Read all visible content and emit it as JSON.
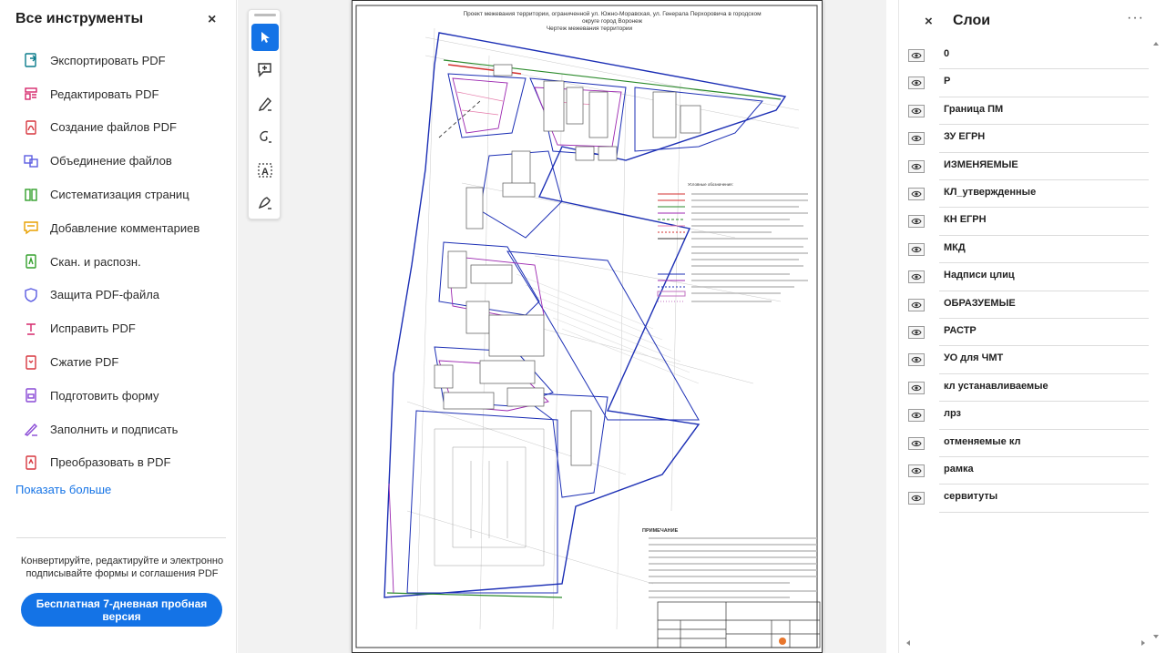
{
  "left_panel": {
    "title": "Все инструменты",
    "close": "×",
    "tools": [
      {
        "label": "Экспортировать PDF",
        "icon": "export-pdf-icon",
        "color": "#0a7c8c"
      },
      {
        "label": "Редактировать PDF",
        "icon": "edit-pdf-icon",
        "color": "#d6286b"
      },
      {
        "label": "Создание файлов PDF",
        "icon": "create-pdf-icon",
        "color": "#d7373f"
      },
      {
        "label": "Объединение файлов",
        "icon": "combine-files-icon",
        "color": "#5b5ce2"
      },
      {
        "label": "Систематизация страниц",
        "icon": "organize-pages-icon",
        "color": "#33a02c"
      },
      {
        "label": "Добавление комментариев",
        "icon": "comment-icon",
        "color": "#e8a000"
      },
      {
        "label": "Скан. и распозн.",
        "icon": "scan-ocr-icon",
        "color": "#33a02c"
      },
      {
        "label": "Защита PDF-файла",
        "icon": "protect-pdf-icon",
        "color": "#5b5ce2"
      },
      {
        "label": "Исправить PDF",
        "icon": "redact-pdf-icon",
        "color": "#d6286b"
      },
      {
        "label": "Сжатие PDF",
        "icon": "compress-pdf-icon",
        "color": "#d7373f"
      },
      {
        "label": "Подготовить форму",
        "icon": "prepare-form-icon",
        "color": "#8a4ad6"
      },
      {
        "label": "Заполнить и подписать",
        "icon": "fill-sign-icon",
        "color": "#8a4ad6"
      },
      {
        "label": "Преобразовать в PDF",
        "icon": "convert-pdf-icon",
        "color": "#d7373f"
      }
    ],
    "show_more": "Показать больше",
    "promo_text": "Конвертируйте, редактируйте и электронно подписывайте формы и соглашения PDF",
    "promo_button": "Бесплатная 7-дневная пробная версия",
    "accent": "#1473e6"
  },
  "toolbar": {
    "buttons": [
      {
        "name": "select-tool-button",
        "icon": "cursor-icon",
        "active": true
      },
      {
        "name": "add-comment-button",
        "icon": "comment-plus-icon",
        "active": false
      },
      {
        "name": "highlight-button",
        "icon": "pen-icon",
        "active": false
      },
      {
        "name": "draw-button",
        "icon": "freehand-icon",
        "active": false
      },
      {
        "name": "text-select-button",
        "icon": "text-box-icon",
        "active": false
      },
      {
        "name": "sign-button",
        "icon": "sign-icon",
        "active": false
      }
    ]
  },
  "document": {
    "title_line1": "Проект межевания территории, ограниченной ул. Южно-Моравская, ул. Генерала Перхоровича в городском",
    "title_line2": "округе город Воронеж",
    "title_line3": "Чертеж межевания территории",
    "note_heading": "ПРИМЕЧАНИЕ"
  },
  "right_panel": {
    "title": "Слои",
    "close": "×",
    "more": "···",
    "layers": [
      "0",
      "Р",
      "Граница ПМ",
      "ЗУ ЕГРН",
      "ИЗМЕНЯЕМЫЕ",
      "КЛ_утвержденные",
      "КН ЕГРН",
      "МКД",
      "Надписи цлиц",
      "ОБРАЗУЕМЫЕ",
      "РАСТР",
      "УО для ЧМТ",
      "кл устанавливаемые",
      "лрз",
      "отменяемые кл",
      "рамка",
      "сервитуты"
    ]
  }
}
